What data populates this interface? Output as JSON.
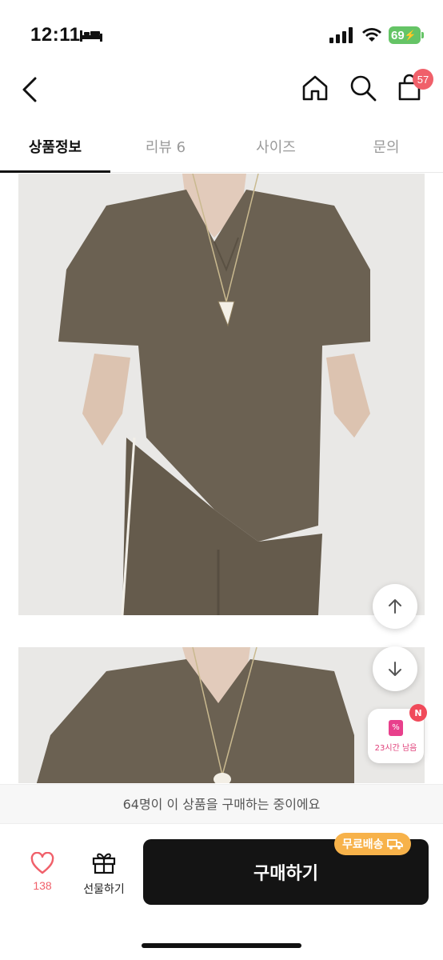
{
  "status_bar": {
    "time": "12:11",
    "battery": "69"
  },
  "cart": {
    "badge_count": "57"
  },
  "tabs": [
    {
      "label": "상품정보",
      "active": true
    },
    {
      "label": "리뷰 6",
      "active": false
    },
    {
      "label": "사이즈",
      "active": false
    },
    {
      "label": "문의",
      "active": false
    }
  ],
  "coupon": {
    "badge": "N",
    "label": "23시간 남음"
  },
  "banner": {
    "text": "64명이 이 상품을 구매하는 중이에요"
  },
  "bottom": {
    "like_count": "138",
    "gift_label": "선물하기",
    "buy_label": "구매하기",
    "shipping_badge": "무료배송"
  },
  "colors": {
    "accent": "#f0606a",
    "buy_button": "#141414",
    "shipping": "#f7b24a",
    "garment": "#6b6152"
  }
}
